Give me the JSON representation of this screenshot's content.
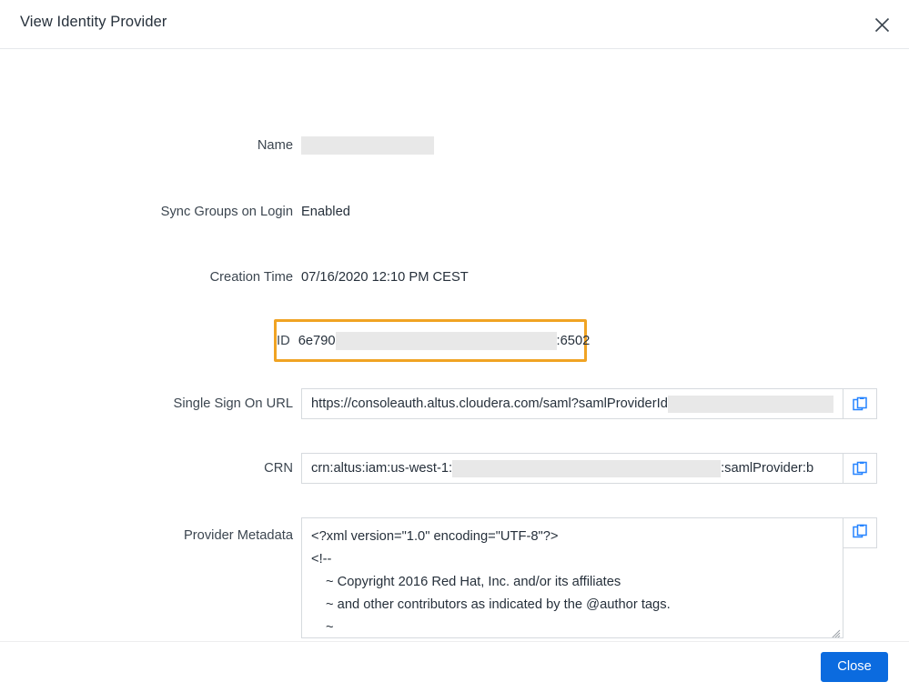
{
  "dialog": {
    "title": "View Identity Provider",
    "close_icon": "close-icon"
  },
  "fields": {
    "name": {
      "label": "Name",
      "value": "",
      "redacted": true
    },
    "sync_groups": {
      "label": "Sync Groups on Login",
      "value": "Enabled"
    },
    "creation_time": {
      "label": "Creation Time",
      "value": "07/16/2020 12:10 PM CEST"
    },
    "id": {
      "label": "ID",
      "value_prefix": "6e790",
      "value_suffix": ":6502",
      "highlight_color": "#f0a323",
      "highlighted": true
    },
    "sso_url": {
      "label": "Single Sign On URL",
      "value_prefix": "https://consoleauth.altus.cloudera.com/saml?samlProviderId",
      "copy_icon": "copy-icon"
    },
    "crn": {
      "label": "CRN",
      "value_prefix": "crn:altus:iam:us-west-1:",
      "value_suffix": ":samlProvider:b",
      "copy_icon": "copy-icon"
    },
    "provider_metadata": {
      "label": "Provider Metadata",
      "copy_icon": "copy-icon",
      "lines": [
        "<?xml version=\"1.0\" encoding=\"UTF-8\"?>",
        "<!--",
        "~ Copyright 2016 Red Hat, Inc. and/or its affiliates",
        "~ and other contributors as indicated by the @author tags.",
        "~"
      ]
    }
  },
  "footer": {
    "close_label": "Close",
    "close_color": "#0b6bdf"
  }
}
